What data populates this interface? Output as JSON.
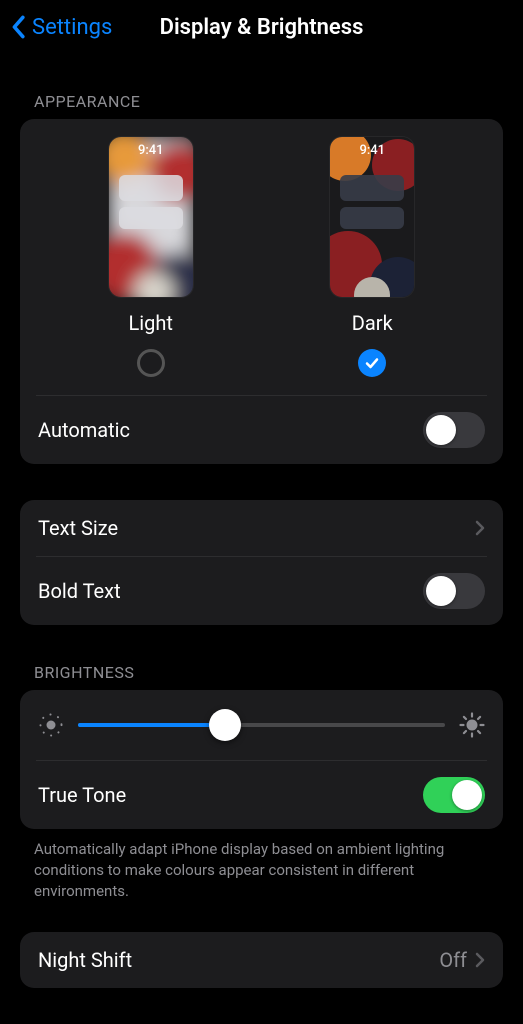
{
  "nav": {
    "back_label": "Settings",
    "title": "Display & Brightness"
  },
  "appearance": {
    "section_label": "APPEARANCE",
    "preview_time": "9:41",
    "options": {
      "light": {
        "label": "Light",
        "selected": false
      },
      "dark": {
        "label": "Dark",
        "selected": true
      }
    },
    "automatic": {
      "label": "Automatic",
      "on": false
    }
  },
  "text": {
    "text_size_label": "Text Size",
    "bold_text": {
      "label": "Bold Text",
      "on": false
    }
  },
  "brightness": {
    "section_label": "BRIGHTNESS",
    "slider_percent": 40,
    "true_tone": {
      "label": "True Tone",
      "on": true
    },
    "footnote": "Automatically adapt iPhone display based on ambient lighting conditions to make colours appear consistent in different environments."
  },
  "night_shift": {
    "label": "Night Shift",
    "value": "Off"
  }
}
